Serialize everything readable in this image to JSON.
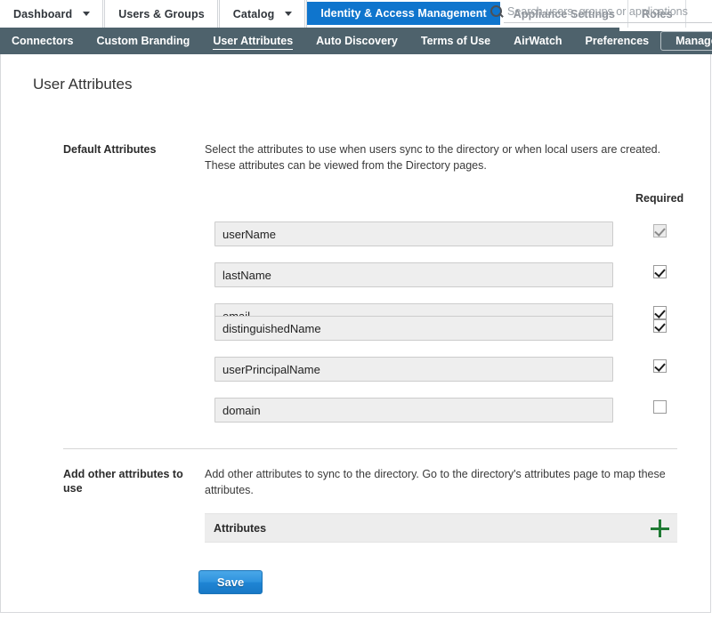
{
  "top_nav": {
    "tabs": [
      {
        "label": "Dashboard",
        "has_caret": true,
        "active": false
      },
      {
        "label": "Users & Groups",
        "has_caret": false,
        "active": false
      },
      {
        "label": "Catalog",
        "has_caret": true,
        "active": false
      },
      {
        "label": "Identity & Access Management",
        "has_caret": false,
        "active": true
      },
      {
        "label": "Appliance Settings",
        "has_caret": false,
        "active": false
      },
      {
        "label": "Roles",
        "has_caret": false,
        "active": false
      }
    ],
    "search": {
      "placeholder": "Search users, groups or applications",
      "value": "",
      "icon": "search-icon"
    }
  },
  "sub_nav": {
    "items": [
      {
        "label": "Connectors",
        "current": false
      },
      {
        "label": "Custom Branding",
        "current": false
      },
      {
        "label": "User Attributes",
        "current": true
      },
      {
        "label": "Auto Discovery",
        "current": false
      },
      {
        "label": "Terms of Use",
        "current": false
      },
      {
        "label": "AirWatch",
        "current": false
      },
      {
        "label": "Preferences",
        "current": false
      }
    ],
    "manage_label": "Manage",
    "background_color": "#4e626c"
  },
  "page": {
    "title": "User Attributes"
  },
  "default_attributes": {
    "label": "Default Attributes",
    "description": "Select the attributes to use when users sync to the directory or when local users are created. These attributes can be viewed from the Directory pages.",
    "required_column_header": "Required",
    "rows": [
      {
        "name": "userName",
        "required": true,
        "disabled": true
      },
      {
        "name": "lastName",
        "required": true,
        "disabled": false
      },
      {
        "name": "email",
        "required": true,
        "disabled": false
      },
      {
        "name": "distinguishedName",
        "required": true,
        "disabled": false
      },
      {
        "name": "userPrincipalName",
        "required": true,
        "disabled": false
      },
      {
        "name": "domain",
        "required": false,
        "disabled": false
      }
    ]
  },
  "add_other_attributes": {
    "label": "Add other attributes to use",
    "description": "Add other attributes to sync to the directory. Go to the directory's attributes page to map these attributes.",
    "table_column_header": "Attributes",
    "add_icon": "plus-icon",
    "add_icon_color": "#1f7a33"
  },
  "actions": {
    "save_label": "Save",
    "save_color": "#2f93de"
  }
}
